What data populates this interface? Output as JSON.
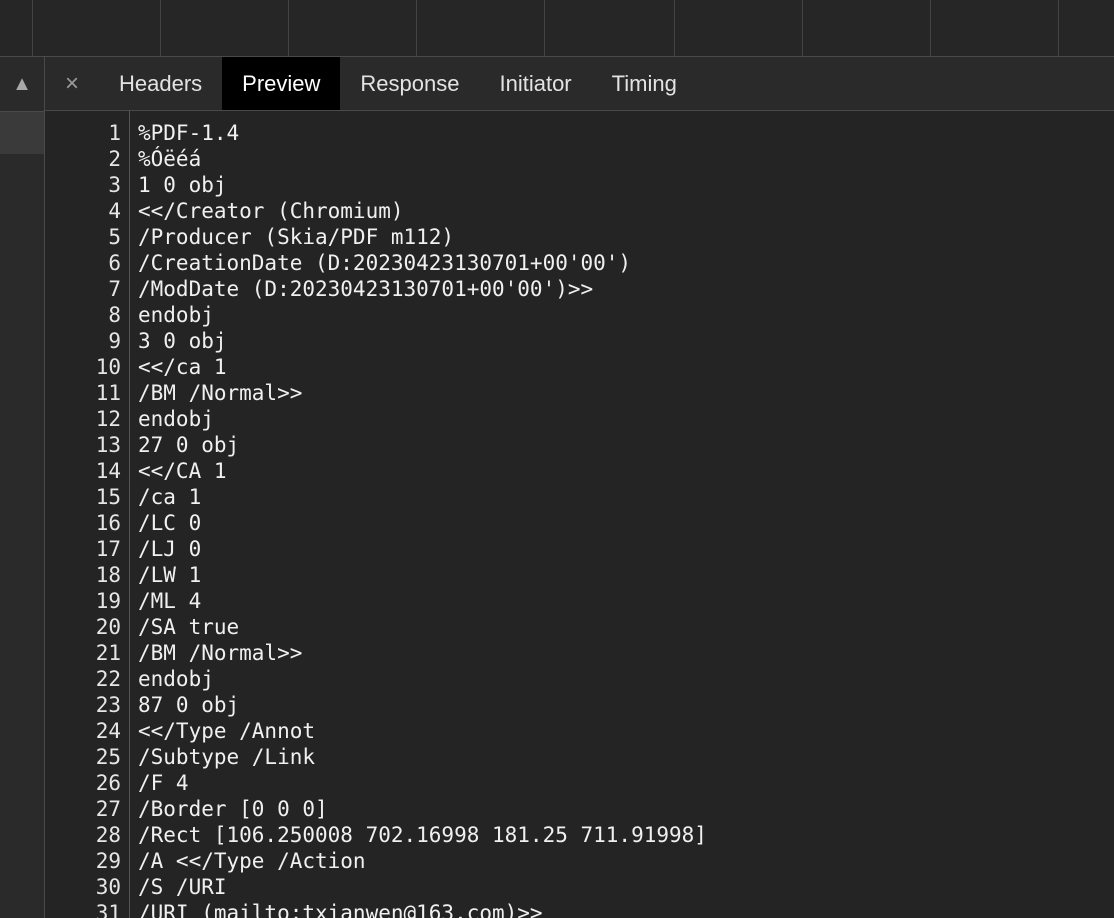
{
  "panel": {
    "scroll_up_glyph": "▲",
    "close_glyph": "×"
  },
  "tabs": [
    {
      "label": "Headers",
      "active": false
    },
    {
      "label": "Preview",
      "active": true
    },
    {
      "label": "Response",
      "active": false
    },
    {
      "label": "Initiator",
      "active": false
    },
    {
      "label": "Timing",
      "active": false
    }
  ],
  "code_lines": [
    {
      "n": "1",
      "text": "%PDF-1.4"
    },
    {
      "n": "2",
      "text": "%Óëéá"
    },
    {
      "n": "3",
      "text": "1 0 obj"
    },
    {
      "n": "4",
      "text": "<</Creator (Chromium)"
    },
    {
      "n": "5",
      "text": "/Producer (Skia/PDF m112)"
    },
    {
      "n": "6",
      "text": "/CreationDate (D:20230423130701+00'00')"
    },
    {
      "n": "7",
      "text": "/ModDate (D:20230423130701+00'00')>>"
    },
    {
      "n": "8",
      "text": "endobj"
    },
    {
      "n": "9",
      "text": "3 0 obj"
    },
    {
      "n": "10",
      "text": "<</ca 1"
    },
    {
      "n": "11",
      "text": "/BM /Normal>>"
    },
    {
      "n": "12",
      "text": "endobj"
    },
    {
      "n": "13",
      "text": "27 0 obj"
    },
    {
      "n": "14",
      "text": "<</CA 1"
    },
    {
      "n": "15",
      "text": "/ca 1"
    },
    {
      "n": "16",
      "text": "/LC 0"
    },
    {
      "n": "17",
      "text": "/LJ 0"
    },
    {
      "n": "18",
      "text": "/LW 1"
    },
    {
      "n": "19",
      "text": "/ML 4"
    },
    {
      "n": "20",
      "text": "/SA true"
    },
    {
      "n": "21",
      "text": "/BM /Normal>>"
    },
    {
      "n": "22",
      "text": "endobj"
    },
    {
      "n": "23",
      "text": "87 0 obj"
    },
    {
      "n": "24",
      "text": "<</Type /Annot"
    },
    {
      "n": "25",
      "text": "/Subtype /Link"
    },
    {
      "n": "26",
      "text": "/F 4"
    },
    {
      "n": "27",
      "text": "/Border [0 0 0]"
    },
    {
      "n": "28",
      "text": "/Rect [106.250008 702.16998 181.25 711.91998]"
    },
    {
      "n": "29",
      "text": "/A <</Type /Action"
    },
    {
      "n": "30",
      "text": "/S /URI"
    },
    {
      "n": "31",
      "text": "/URI (mailto:txianwen@163.com)>>"
    }
  ]
}
